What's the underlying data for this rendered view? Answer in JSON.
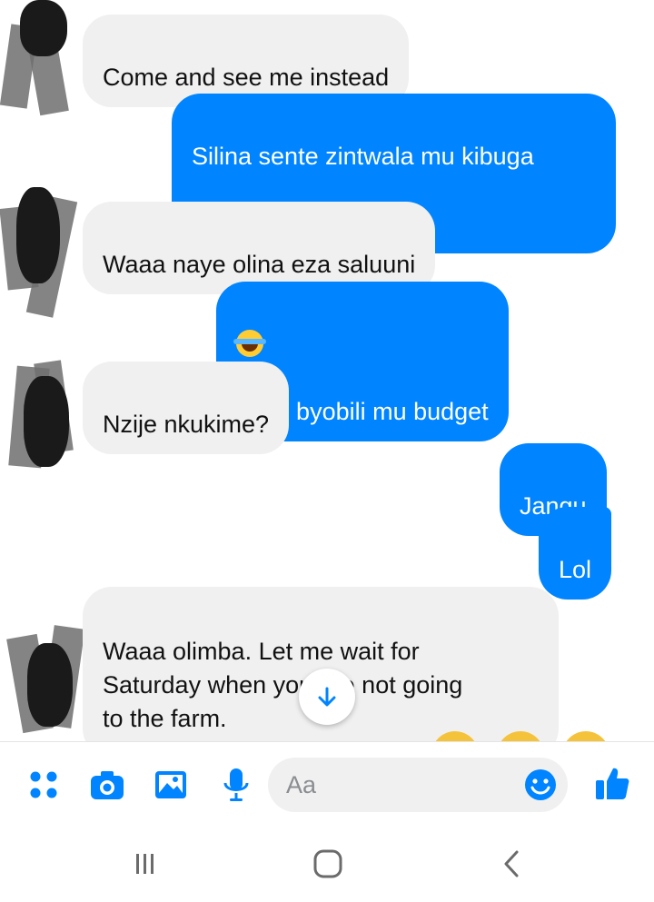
{
  "messages": [
    {
      "side": "in",
      "text": "Come and see me instead"
    },
    {
      "side": "out",
      "text": "Silina sente zintwala mu kibuga"
    },
    {
      "side": "in",
      "text": "Waaa naye olina eza saluuni"
    },
    {
      "side": "out",
      "text": "nanti byobili mu budget"
    },
    {
      "side": "in",
      "text": "Nzije nkukime?"
    },
    {
      "side": "out",
      "text": "Jangu"
    },
    {
      "side": "out",
      "text": "Lol"
    },
    {
      "side": "in",
      "text": "Waaa olimba. Let me wait for\nSaturday when you are not going\nto the farm."
    }
  ],
  "emoji": {
    "smirk": "smirking-face-icon",
    "tears_of_joy": "face-with-tears-of-joy-icon"
  },
  "composer": {
    "placeholder": "Aa",
    "icons": [
      "apps-icon",
      "camera-icon",
      "gallery-icon",
      "microphone-icon",
      "emoji-icon",
      "thumbs-up-icon"
    ]
  },
  "navbar": {
    "icons": [
      "recent-apps-icon",
      "home-icon",
      "back-icon"
    ]
  },
  "colors": {
    "accent": "#0084ff",
    "incoming_bubble": "#f0f0f0",
    "background": "#ffffff"
  }
}
